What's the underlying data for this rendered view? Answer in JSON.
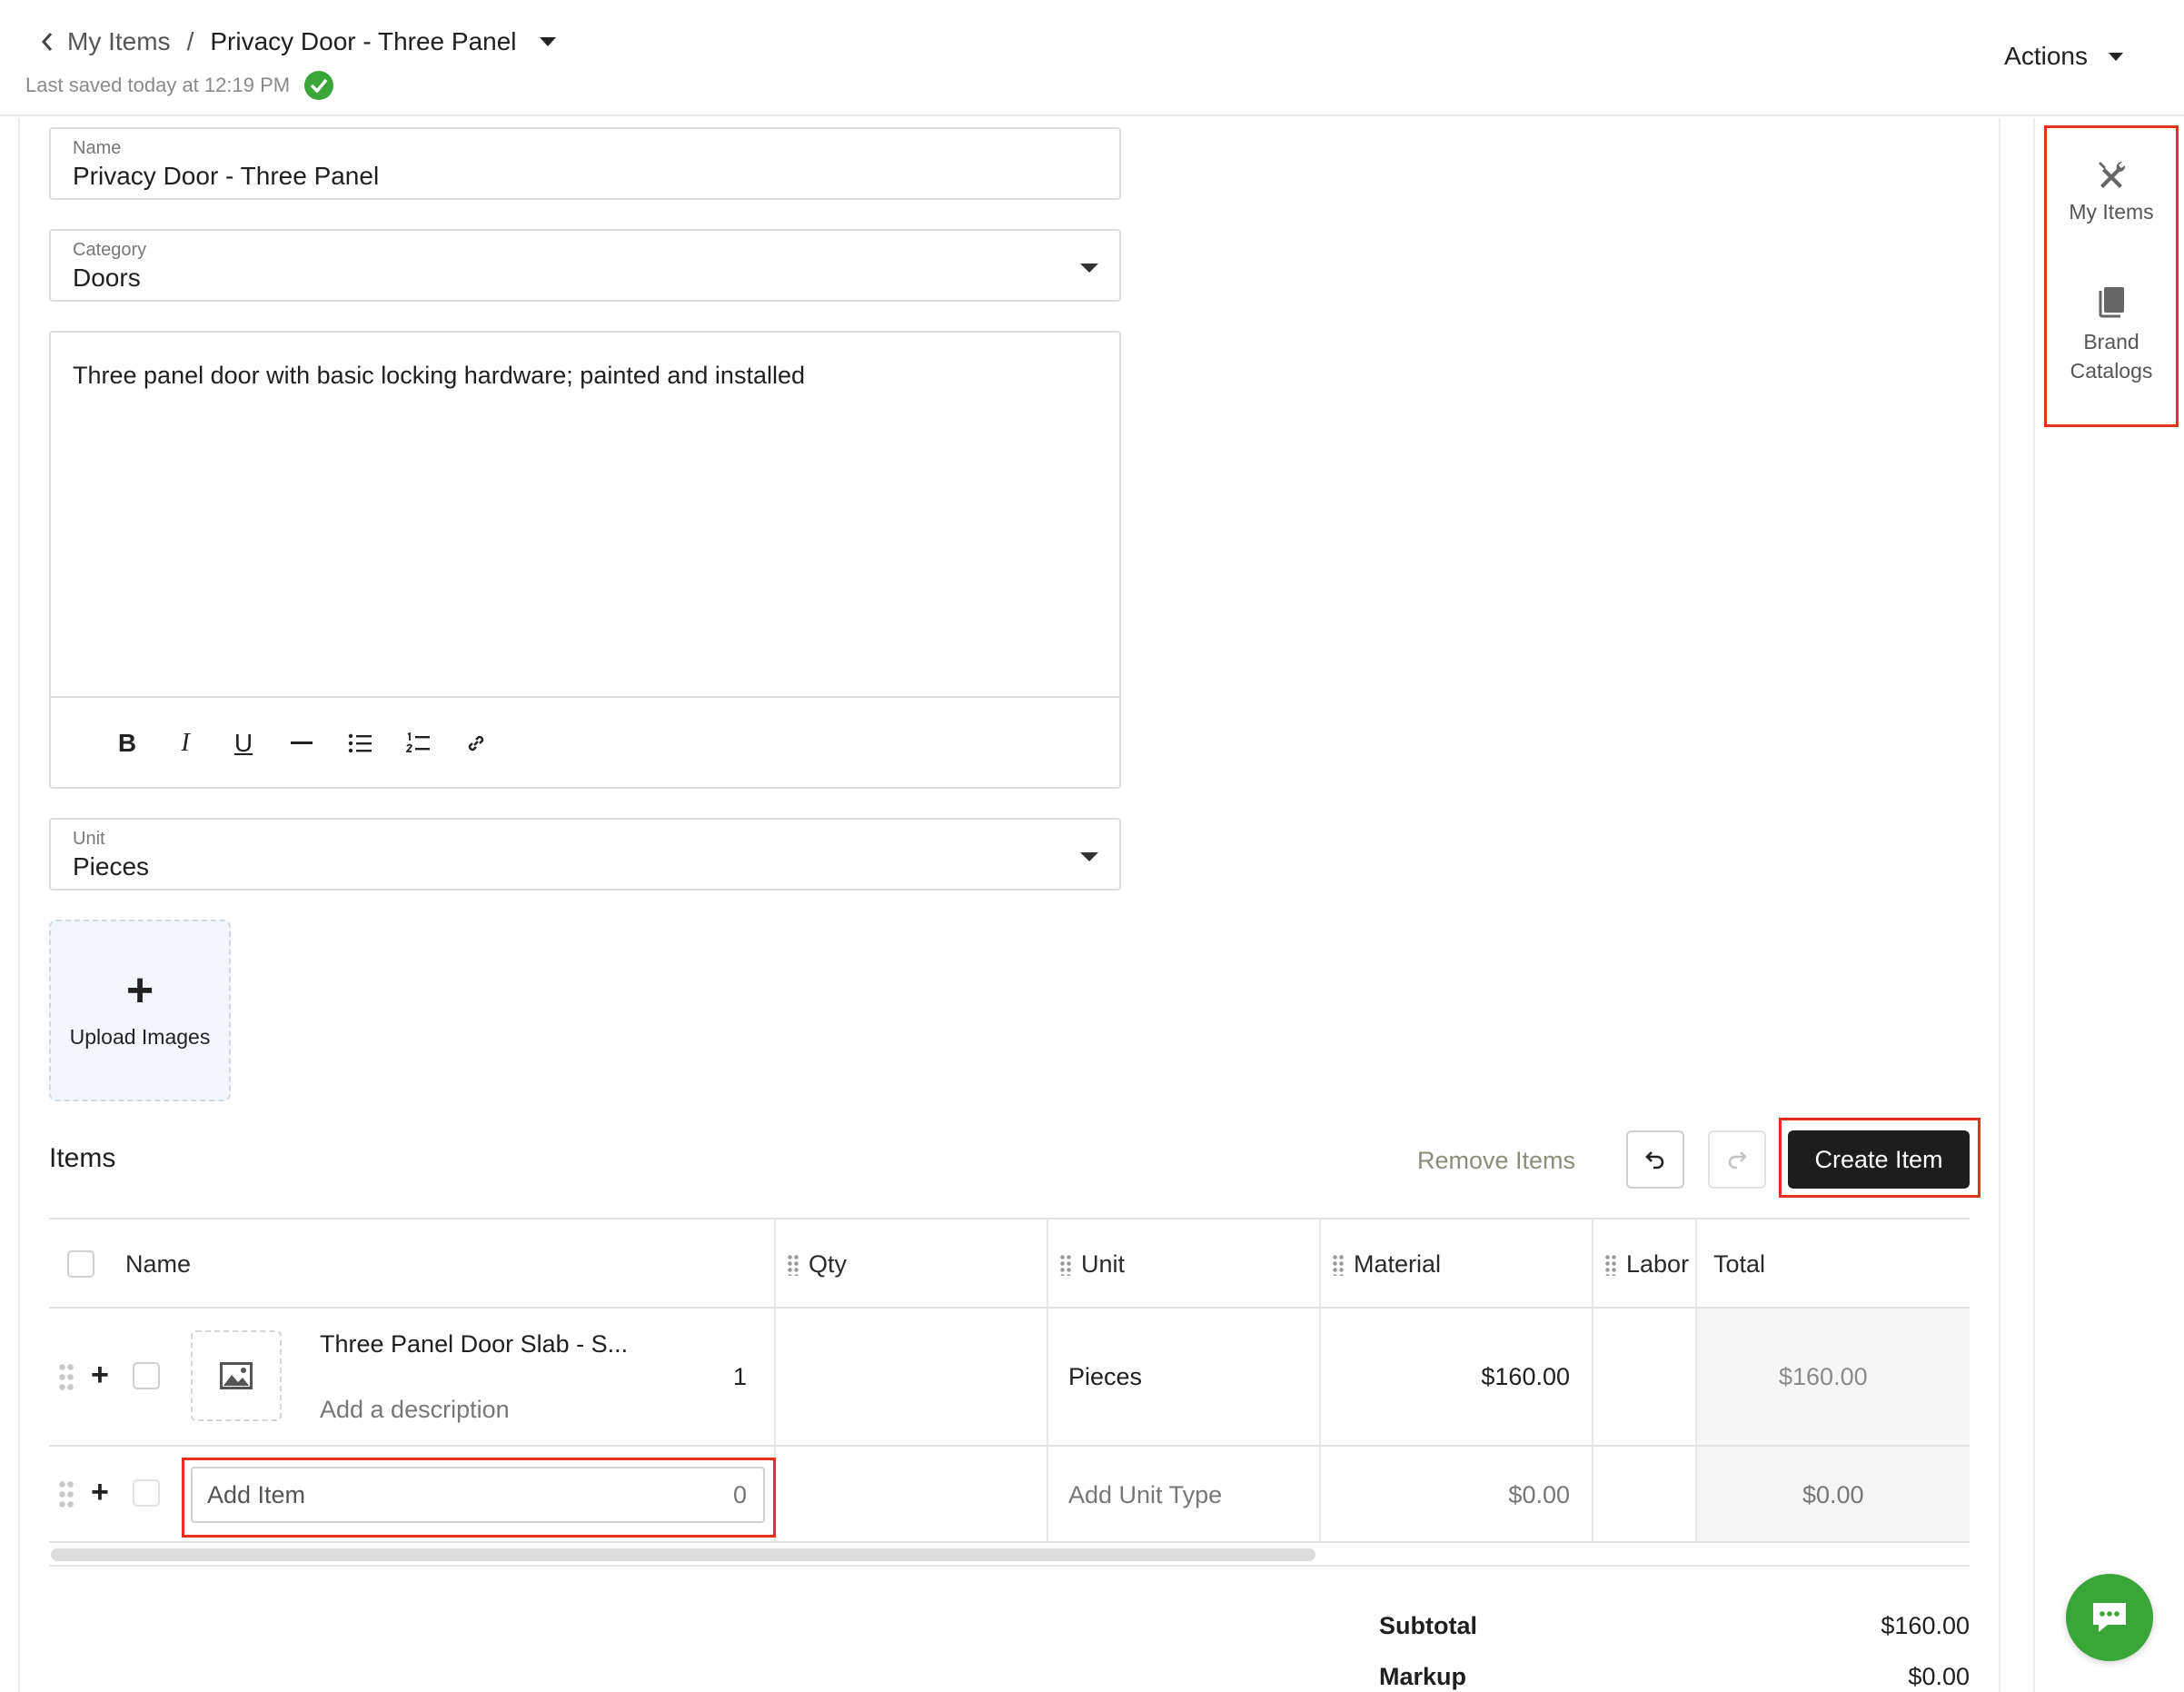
{
  "header": {
    "breadcrumb_parent": "My Items",
    "breadcrumb_separator": "/",
    "title": "Privacy Door - Three Panel",
    "saved_text": "Last saved today at 12:19 PM",
    "actions_label": "Actions"
  },
  "form": {
    "name_label": "Name",
    "name_value": "Privacy Door - Three Panel",
    "category_label": "Category",
    "category_value": "Doors",
    "description": "Three panel door with basic locking hardware; painted and installed",
    "unit_label": "Unit",
    "unit_value": "Pieces",
    "upload_label": "Upload Images",
    "toolbar": {
      "bold": "B",
      "italic": "I",
      "underline": "U"
    }
  },
  "items": {
    "title": "Items",
    "remove_label": "Remove Items",
    "create_label": "Create Item",
    "columns": {
      "name": "Name",
      "qty": "Qty",
      "unit": "Unit",
      "material": "Material",
      "labor": "Labor",
      "total": "Total"
    },
    "rows": [
      {
        "name": "Three Panel Door Slab - S...",
        "description_placeholder": "Add a description",
        "qty": "1",
        "unit": "Pieces",
        "material": "$160.00",
        "labor": "",
        "total": "$160.00"
      }
    ],
    "new_row": {
      "name_placeholder": "Add Item",
      "qty": "0",
      "unit_placeholder": "Add Unit Type",
      "material": "$0.00",
      "total": "$0.00"
    }
  },
  "summary": {
    "subtotal_label": "Subtotal",
    "subtotal_value": "$160.00",
    "markup_label": "Markup",
    "markup_value": "$0.00"
  },
  "rail": {
    "my_items": "My Items",
    "brand_line1": "Brand",
    "brand_line2": "Catalogs"
  },
  "colors": {
    "accent_green": "#3aa63a",
    "highlight_red": "#e4321f",
    "primary_button": "#1d1d1d"
  }
}
